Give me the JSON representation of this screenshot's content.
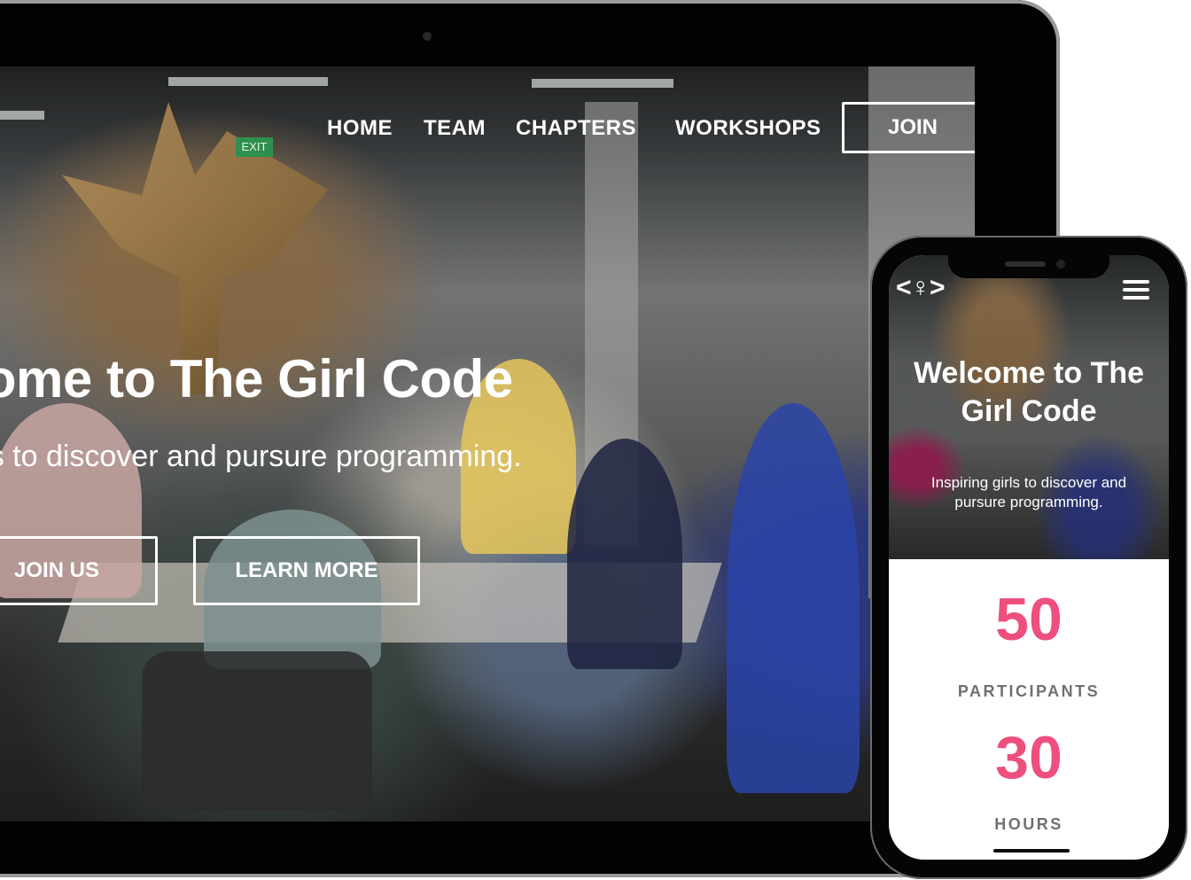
{
  "desktop": {
    "nav": {
      "home": "HOME",
      "team": "TEAM",
      "chapters": "CHAPTERS",
      "workshops": "WORKSHOPS",
      "join": "JOIN"
    },
    "hero": {
      "title": "elcome to The Girl Code",
      "subtitle": "g girls to discover and pursure programming.",
      "join_us_label": "JOIN US",
      "learn_more_label": "LEARN MORE"
    },
    "exit_sign": "EXIT"
  },
  "mobile": {
    "logo": "<♀>",
    "menu_icon": "hamburger-menu-icon",
    "hero": {
      "title": "Welcome to The Girl Code",
      "subtitle": "Inspiring girls to discover and pursure programming."
    },
    "stats": [
      {
        "value": "50",
        "label": "PARTICIPANTS"
      },
      {
        "value": "30",
        "label": "HOURS"
      }
    ]
  },
  "colors": {
    "accent_pink": "#ee4f7d",
    "stat_label_gray": "#707070",
    "device_black": "#050505"
  }
}
